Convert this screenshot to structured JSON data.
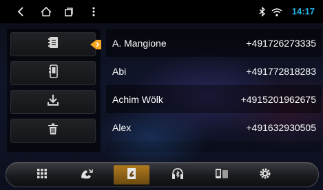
{
  "status_bar": {
    "time": "14:17",
    "icons": [
      "back-icon",
      "home-icon",
      "recent-apps-icon",
      "overflow-menu-icon",
      "bluetooth-icon",
      "wifi-icon"
    ]
  },
  "side_actions": [
    "contacts-book-icon",
    "phone-contacts-icon",
    "download-contacts-icon",
    "delete-icon"
  ],
  "contacts": [
    {
      "name": "A. Mangione",
      "phone": "+491726273335"
    },
    {
      "name": "Abi",
      "phone": "+491772818283"
    },
    {
      "name": "Achim Wölk",
      "phone": "+4915201962675"
    },
    {
      "name": "Alex",
      "phone": "+491632930505"
    }
  ],
  "bottom_nav": {
    "items": [
      "dialpad-icon",
      "call-log-icon",
      "contacts-icon",
      "bluetooth-music-icon",
      "phone-link-icon",
      "settings-icon"
    ],
    "active": "contacts-icon"
  },
  "colors": {
    "accent": "#23b4e6",
    "active_tab": "#b07a1e",
    "indicator": "#f5a623"
  }
}
